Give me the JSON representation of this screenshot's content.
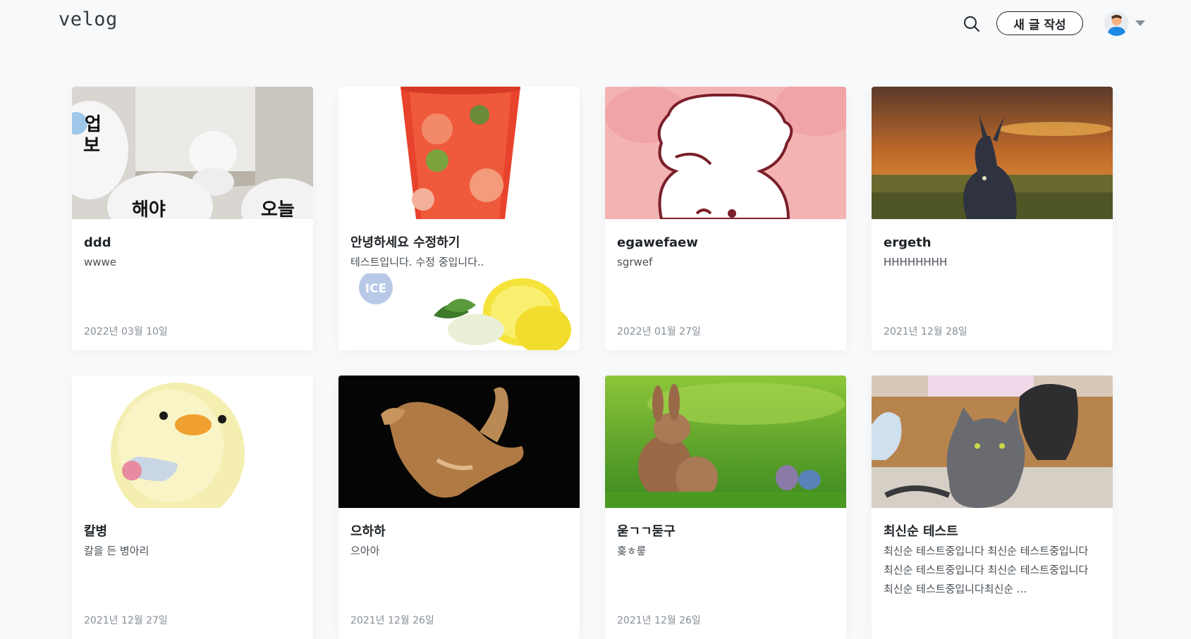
{
  "header": {
    "logo": "velog",
    "write_label": "새 글 작성",
    "search_icon": "search-icon",
    "avatar_icon": "user-avatar-icon",
    "menu_icon": "caret-down-icon"
  },
  "posts": [
    {
      "title": "ddd",
      "description": "wwwe",
      "date": "2022년 03월 10일",
      "thumb_text": [
        "업",
        "보",
        "해야",
        "오늘"
      ]
    },
    {
      "title": "안녕하세요 수정하기",
      "description": "테스트입니다. 수정 중입니다..",
      "date": "",
      "badge": "ICE"
    },
    {
      "title": "egawefaew",
      "description": "sgrwef",
      "date": "2022년 01월 27일"
    },
    {
      "title": "ergeth",
      "description": "HHHHHHHH",
      "date": "2021년 12월 28일"
    },
    {
      "title": "칼병",
      "description": "칼을 든 병아리",
      "date": "2021년 12월 27일"
    },
    {
      "title": "으하하",
      "description": "으아아",
      "date": "2021년 12월 26일"
    },
    {
      "title": "욷ㄱㄱ둗구",
      "description": "홎ㅎ릏",
      "date": "2021년 12월 26일"
    },
    {
      "title": "최신순 테스트",
      "description": "최신순 테스트중입니다 최신순 테스트중입니다 최신순 테스트중입니다 최신순 테스트중입니다 최신순 테스트중입니다최신순 ...",
      "date": ""
    }
  ],
  "colors": {
    "background": "#f8f9fa",
    "text": "#212529",
    "muted": "#868e96"
  }
}
